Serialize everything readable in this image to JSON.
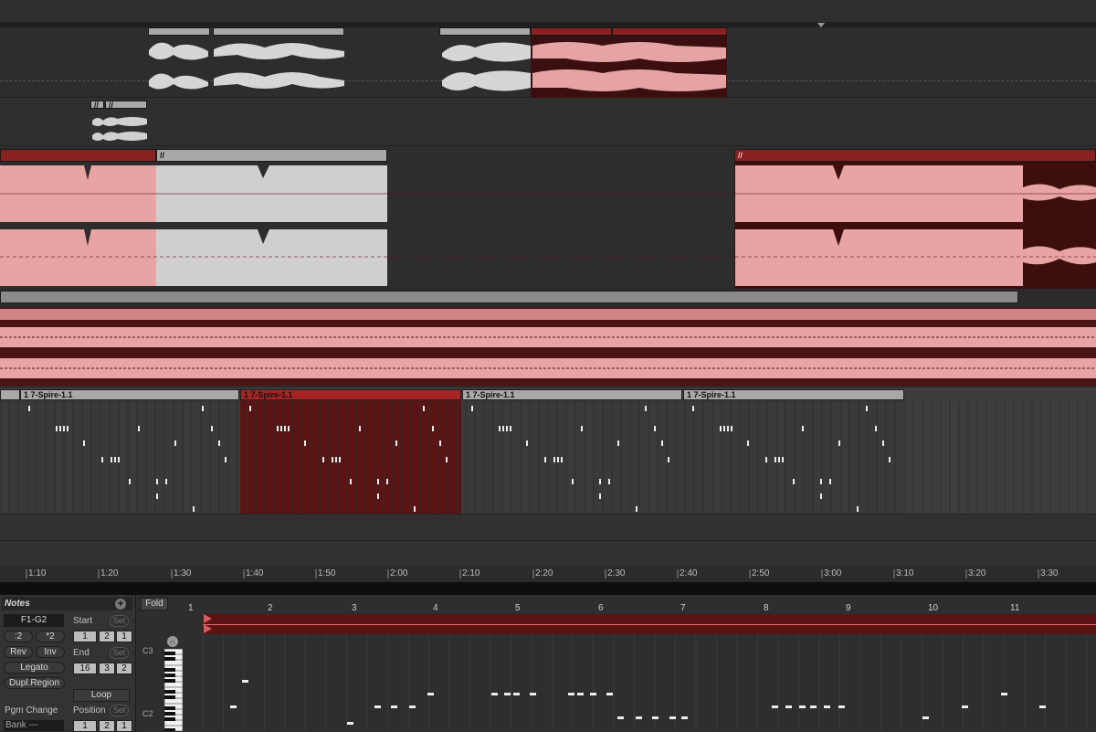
{
  "arrangement": {
    "midi_clip_label": "1 7-Spire-1.1",
    "clip_marker": "//",
    "timeline_ticks": [
      "1:10",
      "1:20",
      "1:30",
      "1:40",
      "1:50",
      "2:00",
      "2:10",
      "2:20",
      "2:30",
      "2:40",
      "2:50",
      "3:00",
      "3:10",
      "3:20",
      "3:30"
    ]
  },
  "notes_panel": {
    "title": "Notes",
    "range_label": "F1-G2",
    "half_button": ":2",
    "double_button": "*2",
    "rev_button": "Rev",
    "inv_button": "Inv",
    "legato_button": "Legato",
    "dupl_region_button": "Dupl.Region",
    "pgm_change_label": "Pgm Change",
    "bank_label": "Bank ---",
    "start_label": "Start",
    "start_values": [
      "1",
      "2",
      "1"
    ],
    "end_label": "End",
    "end_values": [
      "16",
      "3",
      "2"
    ],
    "set_label": "Set",
    "loop_button": "Loop",
    "position_label": "Position",
    "position_values": [
      "1",
      "2",
      "1"
    ]
  },
  "clip_editor": {
    "fold_button": "Fold",
    "bar_numbers": [
      "1",
      "2",
      "3",
      "4",
      "5",
      "6",
      "7",
      "8",
      "9",
      "10",
      "11"
    ],
    "key_labels": [
      "C3",
      "C2"
    ]
  },
  "colors": {
    "selected_red": "#e8a4a4",
    "dark_red": "#5a1414",
    "clip_gray": "#cfcfcf",
    "background": "#2b2b2b"
  }
}
